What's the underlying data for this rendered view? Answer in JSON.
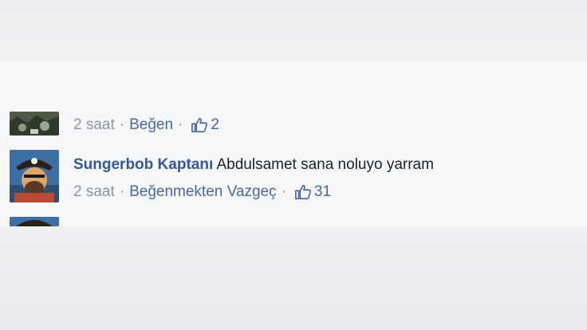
{
  "comment_prev": {
    "time": "2 saat",
    "like_action": "Beğen",
    "like_count": "2"
  },
  "comment_main": {
    "author": "Sungerbob Kaptanı",
    "text": "Abdulsamet sana noluyo yarram",
    "time": "2 saat",
    "like_action": "Beğenmekten Vazgeç",
    "like_count": "31"
  },
  "separator": "·",
  "icons": {
    "like": "thumbs-up-icon"
  },
  "colors": {
    "link": "#4b67a1",
    "author": "#365899",
    "meta": "#90949c",
    "text": "#1d2129"
  }
}
